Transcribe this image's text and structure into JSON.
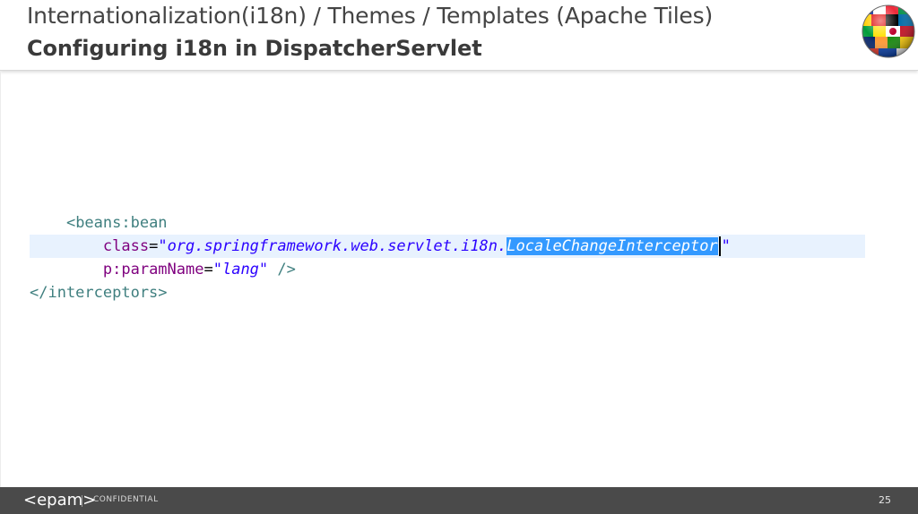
{
  "header": {
    "title_line1": "Internationalization(i18n) / Themes / Templates (Apache Tiles)",
    "title_line2": "Configuring i18n in DispatcherServlet",
    "logo_icon": "globe-flags-icon"
  },
  "code": {
    "line1_tag": "<beans:bean",
    "line2_attr": "class",
    "line2_eq": "=",
    "line2_value_prefix": "\"org.springframework.web.servlet.i18n.",
    "line2_value_selected": "LocaleChangeInterceptor",
    "line2_value_suffix": "\"",
    "line3_attr": "p:paramName",
    "line3_eq": "=",
    "line3_value": "\"lang\"",
    "line3_close": " />",
    "line4_tag": "</interceptors>"
  },
  "footer": {
    "logo": "<epam>",
    "label": "CONFIDENTIAL",
    "page_number": "25"
  },
  "colors": {
    "tag": "#3f7f7f",
    "attribute": "#7f007f",
    "string": "#2a00ff",
    "selection": "#3399ff",
    "current_line": "#e8f2fe",
    "footer_bg": "#4a4a4a"
  }
}
